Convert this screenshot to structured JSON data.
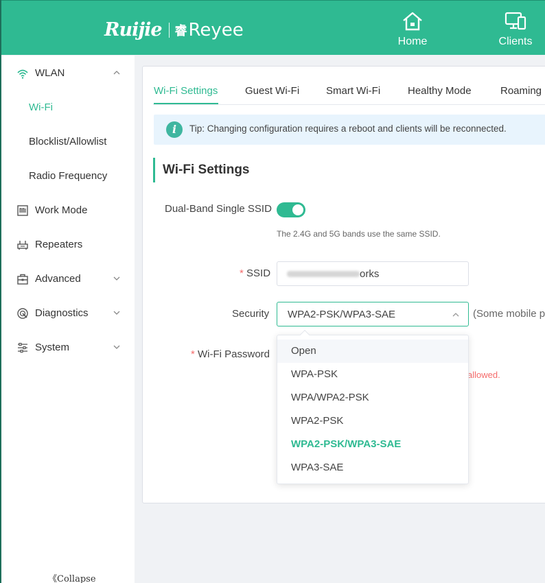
{
  "header": {
    "brand": "Ruijie",
    "brand_mark": "睿",
    "brand2": "Reyee",
    "nav": [
      {
        "label": "Home",
        "icon": "home-icon"
      },
      {
        "label": "Clients",
        "icon": "clients-icon"
      }
    ]
  },
  "sidebar": {
    "items": [
      {
        "label": "WLAN",
        "icon": "wifi-icon",
        "expanded": true
      },
      {
        "label": "Work Mode",
        "icon": "work-mode-icon"
      },
      {
        "label": "Repeaters",
        "icon": "repeater-icon"
      },
      {
        "label": "Advanced",
        "icon": "toolbox-icon"
      },
      {
        "label": "Diagnostics",
        "icon": "diagnostics-icon"
      },
      {
        "label": "System",
        "icon": "system-icon"
      }
    ],
    "sub_items": [
      "Wi-Fi",
      "Blocklist/Allowlist",
      "Radio Frequency"
    ],
    "collapse_label": "《Collapse"
  },
  "tabs": [
    "Wi-Fi Settings",
    "Guest Wi-Fi",
    "Smart Wi-Fi",
    "Healthy Mode",
    "Roaming O"
  ],
  "tip": {
    "icon": "info-icon",
    "text": "Tip: Changing configuration requires a reboot and clients will be reconnected."
  },
  "form": {
    "title": "Wi-Fi Settings",
    "dual_band_label": "Dual-Band Single SSID",
    "dual_band_enabled": true,
    "dual_band_hint": "The 2.4G and 5G bands use the same SSID.",
    "required_mark": "*",
    "ssid_label": "SSID",
    "ssid_value": "orks",
    "security_label": "Security",
    "security_value": "WPA2-PSK/WPA3-SAE",
    "security_note": "(Some mobile p",
    "password_label": "Wi-Fi Password",
    "password_error": "allowed."
  },
  "dropdown": {
    "options": [
      "Open",
      "WPA-PSK",
      "WPA/WPA2-PSK",
      "WPA2-PSK",
      "WPA2-PSK/WPA3-SAE",
      "WPA3-SAE"
    ],
    "hovered": "Open",
    "selected": "WPA2-PSK/WPA3-SAE"
  },
  "colors": {
    "brand": "#2fba92",
    "error": "#f56c6c",
    "tip_bg": "#e8f4fd"
  }
}
